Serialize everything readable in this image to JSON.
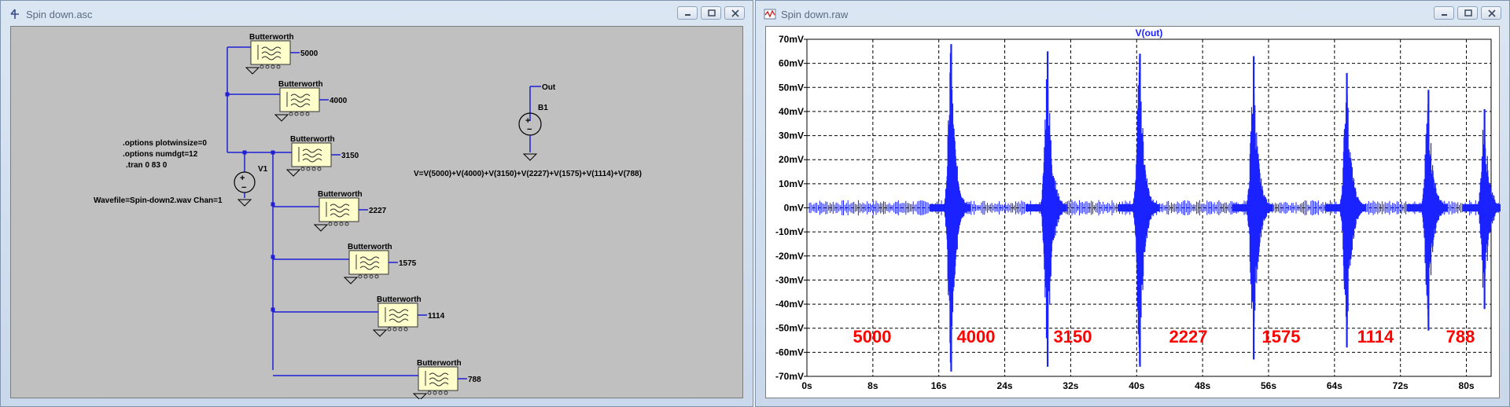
{
  "schematic": {
    "title": "Spin down.asc",
    "filter_label": "Butterworth",
    "filters": [
      "5000",
      "4000",
      "3150",
      "2227",
      "1575",
      "1114",
      "788"
    ],
    "directives": [
      ".options plotwinsize=0",
      ".options numdgt=12",
      ".tran 0 83 0"
    ],
    "wavefile": "Wavefile=Spin-down2.wav Chan=1",
    "v1_label": "V1",
    "b1_label": "B1",
    "out_label": "Out",
    "b1_expression": "V=V(5000)+V(4000)+V(3150)+V(2227)+V(1575)+V(1114)+V(788)"
  },
  "waveform": {
    "title": "Spin down.raw",
    "trace_name": "V(out)"
  },
  "chart_data": {
    "type": "line",
    "title": "V(out)",
    "x_ticks": [
      "0s",
      "8s",
      "16s",
      "24s",
      "32s",
      "40s",
      "48s",
      "56s",
      "64s",
      "72s",
      "80s"
    ],
    "y_ticks": [
      "70mV",
      "60mV",
      "50mV",
      "40mV",
      "30mV",
      "20mV",
      "10mV",
      "0mV",
      "-10mV",
      "-20mV",
      "-30mV",
      "-40mV",
      "-50mV",
      "-60mV",
      "-70mV"
    ],
    "xlim": [
      0,
      83
    ],
    "ylim": [
      -70,
      70
    ],
    "x_unit": "s",
    "y_unit": "mV",
    "grid": true,
    "series_color": "#1a22ff",
    "bursts": [
      {
        "t": 17.5,
        "peak_pos": 68,
        "peak_neg": -68
      },
      {
        "t": 29.2,
        "peak_pos": 65,
        "peak_neg": -66
      },
      {
        "t": 40.4,
        "peak_pos": 64,
        "peak_neg": -66
      },
      {
        "t": 54.2,
        "peak_pos": 63,
        "peak_neg": -63
      },
      {
        "t": 65.5,
        "peak_pos": 56,
        "peak_neg": -58
      },
      {
        "t": 75.4,
        "peak_pos": 49,
        "peak_neg": -51
      },
      {
        "t": 82.2,
        "peak_pos": 41,
        "peak_neg": -42
      }
    ],
    "annotations": [
      "5000",
      "4000",
      "3150",
      "2227",
      "1575",
      "1114",
      "788"
    ],
    "annotation_color": "#ff0000"
  }
}
